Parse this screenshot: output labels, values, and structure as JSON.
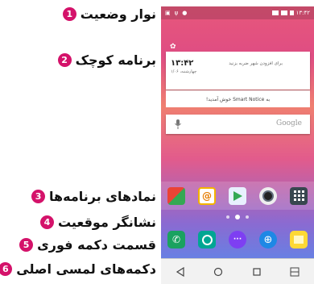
{
  "callouts": [
    {
      "num": "1",
      "text": "نوار وضعیت"
    },
    {
      "num": "2",
      "text": "برنامه کوچک"
    },
    {
      "num": "3",
      "text": "نمادهای برنامه‌ها"
    },
    {
      "num": "4",
      "text": "نشانگر موقعیت"
    },
    {
      "num": "5",
      "text": "قسمت دکمه فوری"
    },
    {
      "num": "6",
      "text": "دکمه‌های لمسی اصلی"
    }
  ],
  "statusbar": {
    "time": "۱۳:۴۲"
  },
  "widget": {
    "time": "۱۳:۴۲",
    "date": "چهارشنبه، ۱/۰۶",
    "weather": "برای افزودن شهر ضربه بزنید"
  },
  "notice": {
    "text": "به Smart Notice خوش آمدید!"
  },
  "search": {
    "placeholder": "Google"
  },
  "colors": {
    "accent": "#d4126a",
    "callout_text": "#111111"
  }
}
